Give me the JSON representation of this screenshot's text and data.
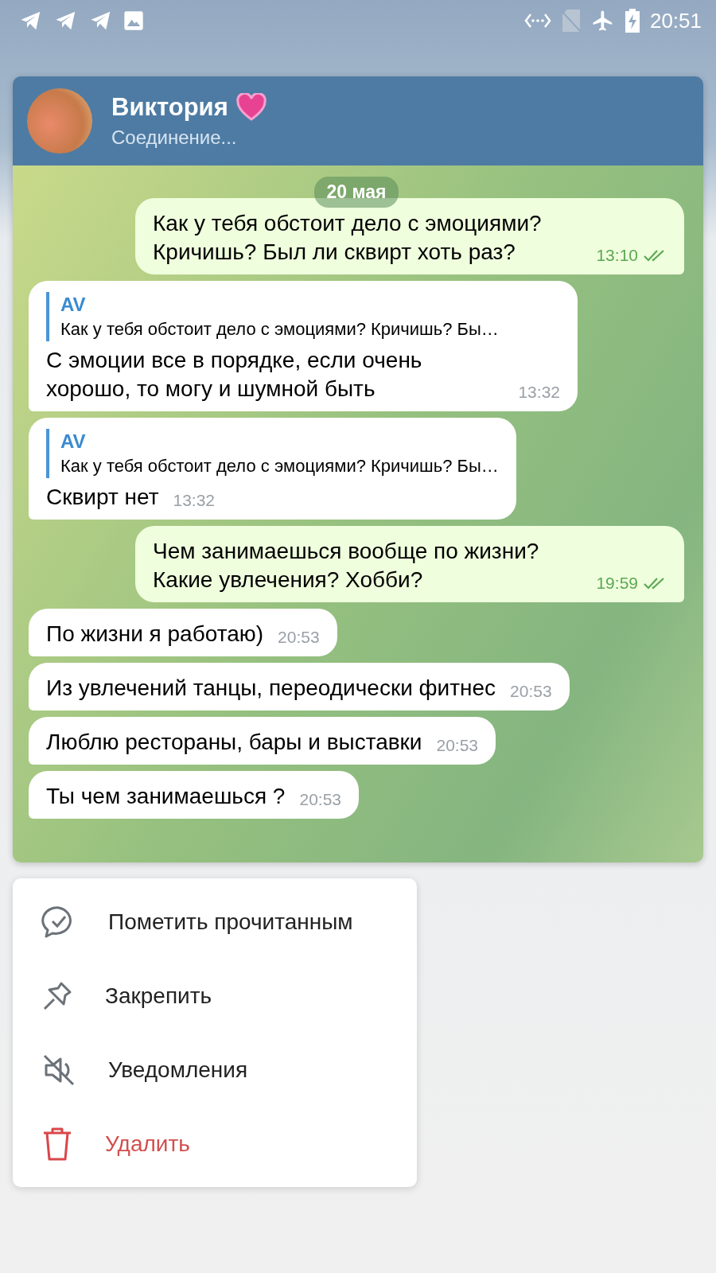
{
  "status_bar": {
    "time": "20:51"
  },
  "chat": {
    "title": "Виктория",
    "status": "Соединение...",
    "date": "20 мая",
    "messages": [
      {
        "kind": "out",
        "text": "Как у тебя обстоит дело с эмоциями? Кричишь? Был ли сквирт хоть раз?",
        "time": "13:10",
        "read": true
      },
      {
        "kind": "in",
        "reply_author": "AV",
        "reply_text": "Как у тебя обстоит дело с эмоциями?  Кричишь? Бы…",
        "text": "С эмоции все в порядке, если очень хорошо, то могу и шумной быть",
        "time": "13:32"
      },
      {
        "kind": "in",
        "reply_author": "AV",
        "reply_text": "Как у тебя обстоит дело с эмоциями?  Кричишь? Бы…",
        "text": "Сквирт нет",
        "time": "13:32"
      },
      {
        "kind": "out",
        "text": "Чем занимаешься вообще по жизни? Какие увлечения? Хобби?",
        "time": "19:59",
        "read": true
      },
      {
        "kind": "in",
        "text": "По жизни я работаю)",
        "time": "20:53"
      },
      {
        "kind": "in",
        "text": "Из увлечений танцы, переодически фитнес",
        "time": "20:53"
      },
      {
        "kind": "in",
        "text": "Люблю рестораны, бары и выставки",
        "time": "20:53"
      },
      {
        "kind": "in",
        "text": "Ты чем занимаешься ?",
        "time": "20:53"
      }
    ]
  },
  "menu": [
    {
      "kind": "mark_read",
      "label": "Пометить прочитанным"
    },
    {
      "kind": "pin",
      "label": "Закрепить"
    },
    {
      "kind": "mute",
      "label": "Уведомления"
    },
    {
      "kind": "delete",
      "label": "Удалить"
    }
  ]
}
